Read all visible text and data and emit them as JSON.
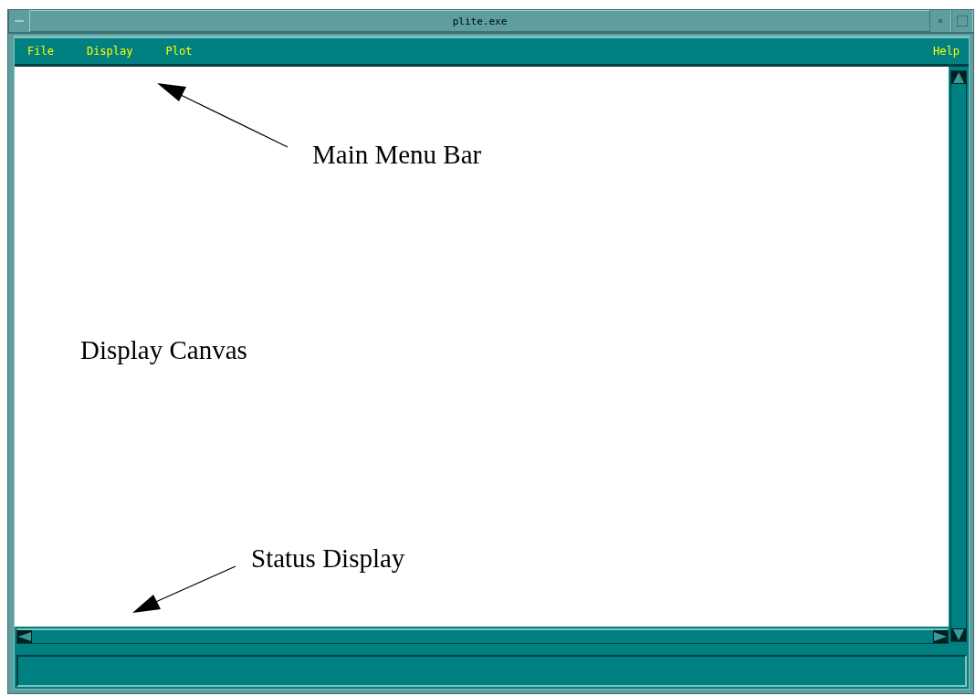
{
  "window": {
    "title": "plite.exe"
  },
  "menu": [
    {
      "label": "File"
    },
    {
      "label": "Display"
    },
    {
      "label": "Plot"
    }
  ],
  "help_menu": {
    "label": "Help"
  },
  "annotations": [
    {
      "text": "Main Menu Bar"
    },
    {
      "text": "Display Canvas"
    },
    {
      "text": "Status Display"
    }
  ]
}
